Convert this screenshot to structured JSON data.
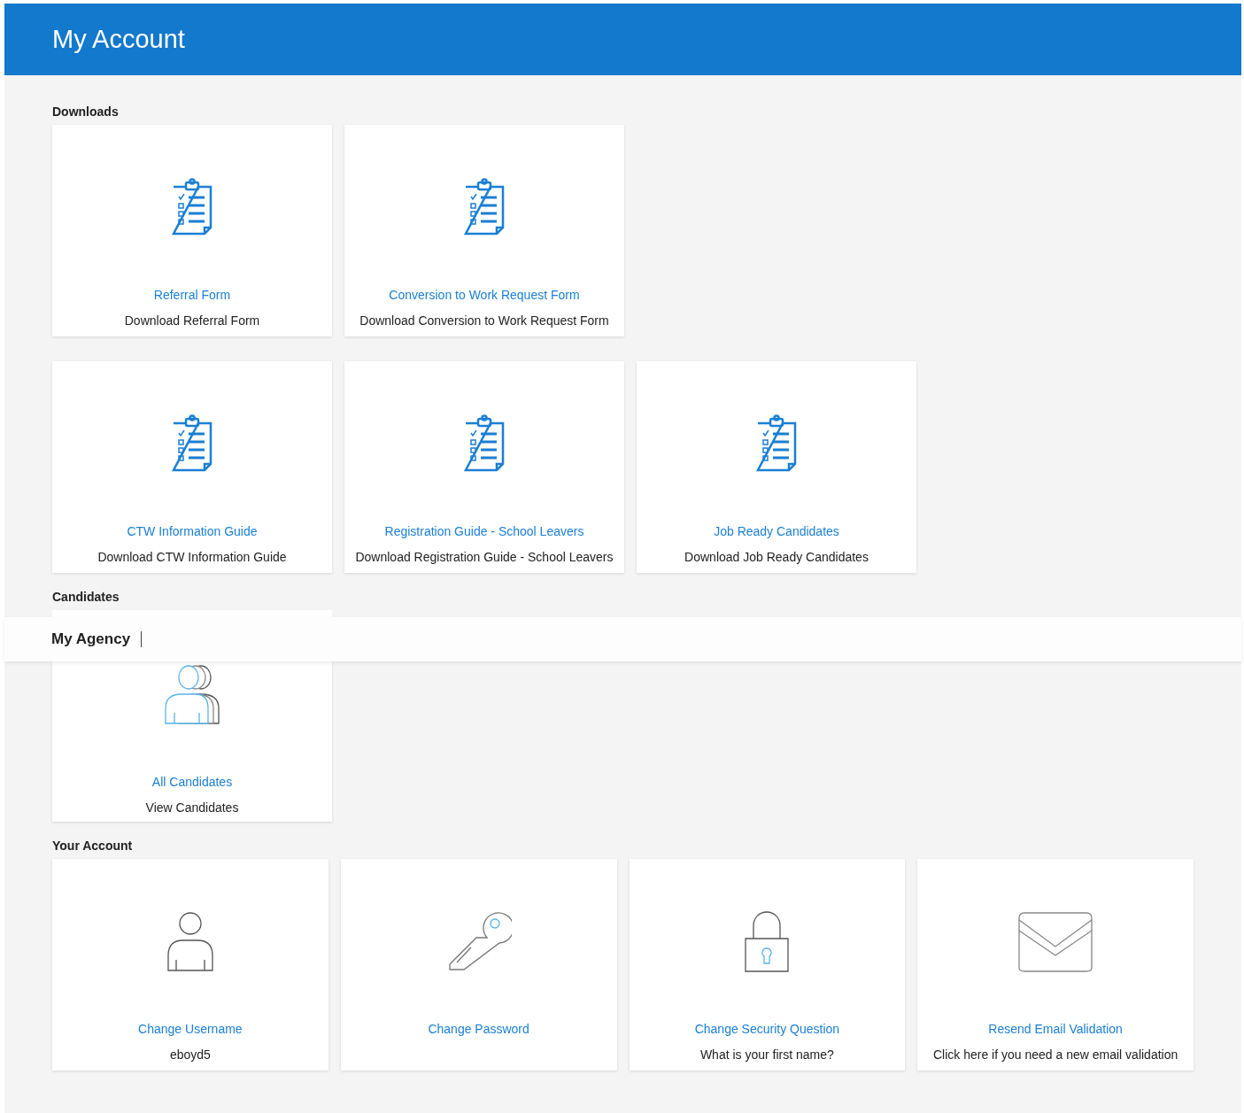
{
  "header": {
    "title": "My Account"
  },
  "sections": [
    {
      "heading": "Downloads",
      "rows": [
        [
          {
            "kind": "clipboard",
            "title": "Referral Form",
            "subtitle": "Download Referral Form"
          },
          {
            "kind": "clipboard",
            "title": "Conversion to Work Request Form",
            "subtitle": "Download Conversion to Work Request Form"
          }
        ],
        [
          {
            "kind": "clipboard",
            "title": "CTW Information Guide",
            "subtitle": "Download CTW Information Guide"
          },
          {
            "kind": "clipboard",
            "title": "Registration Guide - School Leavers",
            "subtitle": "Download Registration Guide - School Leavers"
          },
          {
            "kind": "clipboard",
            "title": "Job Ready Candidates",
            "subtitle": "Download Job Ready Candidates"
          }
        ]
      ]
    },
    {
      "heading": "Candidates",
      "rows": [
        [
          {
            "kind": "people",
            "title": "All Candidates",
            "subtitle": "View Candidates"
          }
        ]
      ]
    },
    {
      "heading": "Your Account",
      "rows": [
        [
          {
            "kind": "user",
            "title": "Change Username",
            "subtitle": "eboyd5"
          },
          {
            "kind": "key",
            "title": "Change Password"
          },
          {
            "kind": "lock",
            "title": "Change Security Question",
            "subtitle": "What is your first name?"
          },
          {
            "kind": "envelope",
            "title": "Resend Email Validation",
            "subtitle": "Click here if you need a new email validation"
          }
        ]
      ]
    }
  ],
  "overlay_bar": {
    "title": "My Agency"
  }
}
